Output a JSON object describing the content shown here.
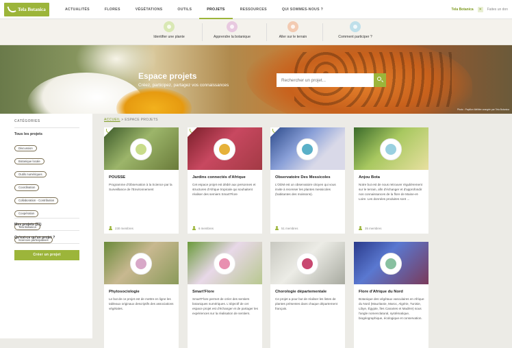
{
  "nav": {
    "logo_text": "Tela Botanica",
    "items": [
      {
        "label": "Actualités",
        "active": false
      },
      {
        "label": "Flores",
        "active": false
      },
      {
        "label": "Végétations",
        "active": false
      },
      {
        "label": "Outils",
        "active": false
      },
      {
        "label": "Projets",
        "active": true
      },
      {
        "label": "Ressources",
        "active": false
      },
      {
        "label": "Qui sommes-nous ?",
        "active": false
      }
    ],
    "user": "Tela Botanica",
    "right_link": "Faites un don"
  },
  "subnav": [
    {
      "label": "Identifier une plante",
      "icon": "plant-icon",
      "color": "#d9e8b4"
    },
    {
      "label": "Apprendre la botanique",
      "icon": "graduation-icon",
      "color": "#e8c9e0"
    },
    {
      "label": "Aller sur le terrain",
      "icon": "sun-icon",
      "color": "#f3cbb2"
    },
    {
      "label": "Comment participer ?",
      "icon": "hand-icon",
      "color": "#bfe0ea"
    }
  ],
  "hero": {
    "title": "Espace projets",
    "subtitle": "Créez, participez, partagez vos connaissances",
    "search_placeholder": "Rechercher un projet...",
    "credit": "Photo : Papillon Mélitée orangée par Tela Botanica"
  },
  "sidebar": {
    "heading": "Catégories",
    "all_label": "Tous les projets",
    "tags": [
      "Discussion",
      "Botanique locale",
      "Outils numériques",
      "Coordination",
      "Collaboration - Contribution",
      "Coopération",
      "Tela Botanica",
      "Sciences participatives"
    ],
    "my_projects": "Mes projets (21)",
    "what_is": "Qu'est-ce qu'un projet ?",
    "create_label": "Créer un projet"
  },
  "breadcrumb": {
    "home": "Accueil",
    "sep": ">",
    "current": "Espace projets"
  },
  "cards": [
    {
      "title": "POUSSE",
      "desc": "Programme d'Observation à la Science par la Surveillance de l'Environnement",
      "members": "230 membres",
      "bg": "linear-gradient(135deg,#3c5a2a,#9cb56a 45%,#6a7b3a)",
      "dot": "#c8dc8a",
      "badge": true
    },
    {
      "title": "Jardins connectés d'Afrique",
      "desc": "Cet espace projet est dédié aux personnes et structures d'Afrique tropicale qui souhaitent réaliser des semiers Smart'Flore",
      "members": "6 membres",
      "bg": "linear-gradient(135deg,#7a1f2a,#c84860 45%,#a33a45)",
      "dot": "#e6b23a",
      "badge": true
    },
    {
      "title": "Observatoire Des Messicoles",
      "desc": "L'ODM est un observatoire citoyen qui vous invite à recenser les plantes messicoles (habitantes des moissons).",
      "members": "51 membres",
      "bg": "linear-gradient(135deg,#2c4a8a,#8aa0d8 40%,#d9d9e8 70%)",
      "dot": "#5ab0c8",
      "badge": true
    },
    {
      "title": "Anjou Bota",
      "desc": "Notre but est de nous retrouver régulièrement sur le terrain, afin d'échanger et d'approfondir nos connaissances de la flore de Maine-et-Loire. Les données produites sont ...",
      "members": "35 membres",
      "bg": "linear-gradient(135deg,#3a6a2a,#a8c860 45%,#e8e0a0)",
      "dot": "#9ad0e0",
      "badge": false
    },
    {
      "title": "Phytosociologie",
      "desc": "Le but de ce projet est de mettre en ligne les tableaux originaux descriptifs des associations végétales.",
      "members": "",
      "bg": "linear-gradient(135deg,#6a8a3a,#c8b890 45%,#8a9a5a)",
      "dot": "#d8a8c8",
      "badge": false
    },
    {
      "title": "Smart'Flore",
      "desc": "Smart'Flore permet de créer des sentiers botaniques numériques. L'objectif de cet espace projet est d'échanger et de partager les expériences sur la réalisation de sentiers.",
      "members": "",
      "bg": "linear-gradient(135deg,#6a9a3a,#e8d8e8 45%,#b8c890)",
      "dot": "#e890b0",
      "badge": false
    },
    {
      "title": "Chorologie départementale",
      "desc": "Ce projet a pour but de réaliser les listes de plantes présentes dans chaque département français.",
      "members": "",
      "bg": "linear-gradient(135deg,#c8c8c0,#ecece6 45%,#a8aaa0)",
      "dot": "#c84870",
      "badge": false
    },
    {
      "title": "Flore d'Afrique du Nord",
      "desc": "Botanique des végétaux vasculaires en Afrique du Nord (Mauritanie, Maroc, Algérie, Tunisie, Libye, Égypte, îles Canaries et Madère) sous l'angle nomenclatural, systématique, biogéographique, écologique et conservation.",
      "members": "",
      "bg": "linear-gradient(135deg,#2a3a8a,#5a78d0 40%,#7a3a5a)",
      "dot": "#88c0a0",
      "badge": false
    }
  ]
}
